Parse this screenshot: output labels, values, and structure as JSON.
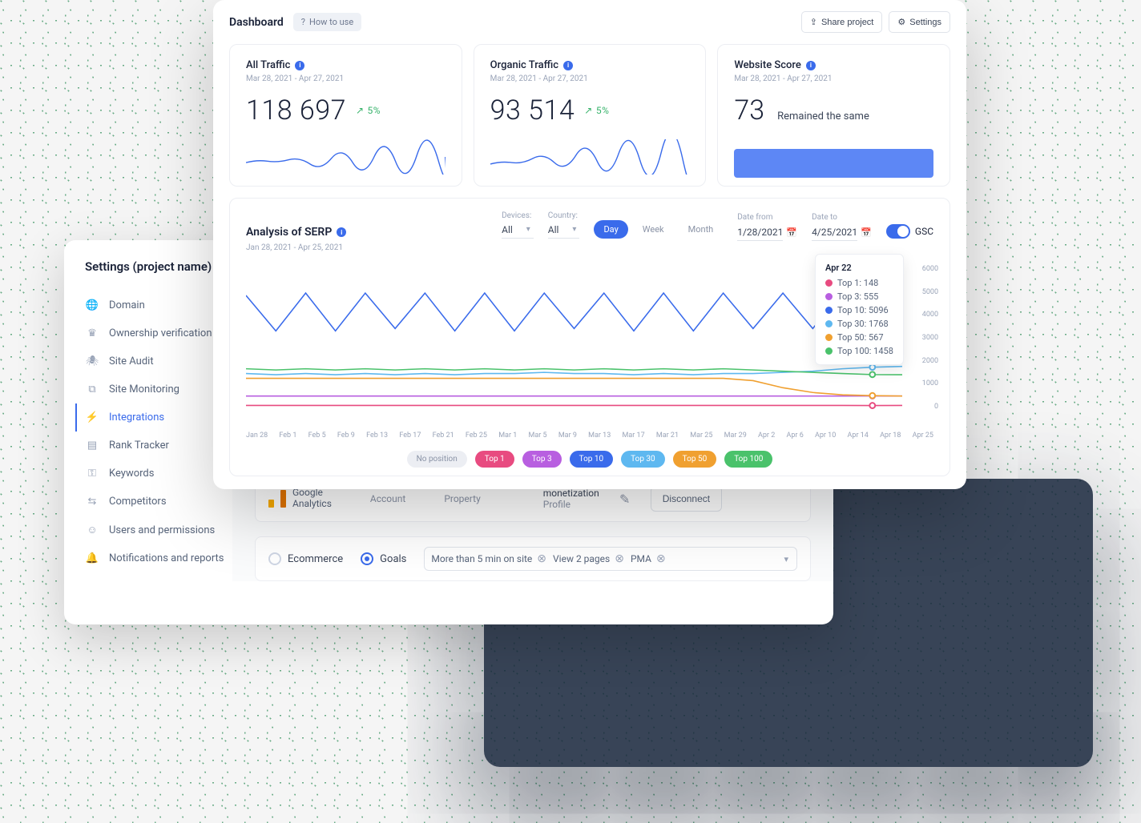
{
  "dashboard": {
    "title": "Dashboard",
    "howto": "How to use",
    "share": "Share project",
    "settings": "Settings"
  },
  "cards": {
    "traffic_all": {
      "title": "All Traffic",
      "date": "Mar 28, 2021 - Apr 27, 2021",
      "value": "118 697",
      "trend": "5%"
    },
    "traffic_org": {
      "title": "Organic Traffic",
      "date": "Mar 28, 2021 - Apr 27, 2021",
      "value": "93 514",
      "trend": "5%"
    },
    "score": {
      "title": "Website Score",
      "date": "Mar 28, 2021 - Apr 27, 2021",
      "value": "73",
      "text": "Remained the same"
    }
  },
  "serp": {
    "title": "Analysis of SERP",
    "sub": "Jan 28, 2021 - Apr 25, 2021",
    "devices_label": "Devices:",
    "devices": "All",
    "country_label": "Country:",
    "country": "All",
    "period_day": "Day",
    "period_week": "Week",
    "period_month": "Month",
    "date_from_label": "Date from",
    "date_from": "1/28/2021",
    "date_to_label": "Date to",
    "date_to": "4/25/2021",
    "gsc": "GSC",
    "tooltip_date": "Apr 22",
    "tt": [
      "Top 1: 148",
      "Top 3: 555",
      "Top 10: 5096",
      "Top 30: 1768",
      "Top 50: 567",
      "Top 100: 1458"
    ],
    "legend_noposition": "No position",
    "legend_top1": "Top 1",
    "legend_top3": "Top 3",
    "legend_top10": "Top 10",
    "legend_top30": "Top 30",
    "legend_top50": "Top 50",
    "legend_top100": "Top 100",
    "xticks": [
      "Jan 28",
      "Feb 1",
      "Feb 5",
      "Feb 9",
      "Feb 13",
      "Feb 17",
      "Feb 21",
      "Feb 25",
      "Mar 1",
      "Mar 5",
      "Mar 9",
      "Mar 13",
      "Mar 17",
      "Mar 21",
      "Mar 25",
      "Mar 29",
      "Apr 2",
      "Apr 6",
      "Apr 10",
      "Apr 14",
      "Apr 18",
      "Apr 25"
    ],
    "yticks": [
      "6000",
      "5000",
      "4000",
      "3000",
      "2000",
      "1000",
      "0"
    ]
  },
  "colors": {
    "top1": "#e84b80",
    "top3": "#b85fe0",
    "top10": "#3a6beb",
    "top30": "#5eb8f0",
    "top50": "#f0a030",
    "top100": "#4ac26b"
  },
  "settings_panel": {
    "title": "Settings (project name)",
    "items": [
      "Domain",
      "Ownership verification",
      "Site Audit",
      "Site Monitoring",
      "Integrations",
      "Rank Tracker",
      "Keywords",
      "Competitors",
      "Users and permissions",
      "Notifications and reports"
    ],
    "ga_name1": "Google",
    "ga_name2": "Analytics",
    "account_label": "Account",
    "property_label": "Property",
    "profile_val": "monetization",
    "profile_label": "Profile",
    "disconnect": "Disconnect",
    "ecommerce": "Ecommerce",
    "goals": "Goals",
    "tags": [
      "More than 5 min on site",
      "View 2 pages",
      "PMA"
    ]
  },
  "chart_data": {
    "type": "line",
    "xlabel": "",
    "ylabel": "",
    "ylim": [
      0,
      6000
    ],
    "categories": [
      "Jan 28",
      "Feb 1",
      "Feb 5",
      "Feb 9",
      "Feb 13",
      "Feb 17",
      "Feb 21",
      "Feb 25",
      "Mar 1",
      "Mar 5",
      "Mar 9",
      "Mar 13",
      "Mar 17",
      "Mar 21",
      "Mar 25",
      "Mar 29",
      "Apr 2",
      "Apr 6",
      "Apr 10",
      "Apr 14",
      "Apr 18",
      "Apr 22",
      "Apr 25"
    ],
    "series": [
      {
        "name": "Top 1",
        "color": "#e84b80",
        "values": [
          150,
          150,
          150,
          150,
          150,
          150,
          150,
          150,
          150,
          150,
          150,
          150,
          150,
          150,
          150,
          150,
          150,
          150,
          150,
          150,
          150,
          148,
          150
        ]
      },
      {
        "name": "Top 3",
        "color": "#b85fe0",
        "values": [
          550,
          550,
          550,
          550,
          550,
          550,
          550,
          550,
          550,
          550,
          550,
          550,
          550,
          550,
          550,
          550,
          550,
          550,
          550,
          550,
          550,
          555,
          550
        ]
      },
      {
        "name": "Top 10",
        "color": "#3a6beb",
        "values": [
          4800,
          3300,
          4900,
          3300,
          4900,
          3400,
          4900,
          3300,
          4900,
          3300,
          4900,
          3400,
          4900,
          3300,
          4900,
          3300,
          4900,
          3400,
          4900,
          3400,
          5000,
          5096,
          3600
        ]
      },
      {
        "name": "Top 30",
        "color": "#5eb8f0",
        "values": [
          1500,
          1450,
          1500,
          1450,
          1500,
          1450,
          1500,
          1450,
          1500,
          1500,
          1550,
          1500,
          1500,
          1450,
          1500,
          1450,
          1500,
          1500,
          1550,
          1600,
          1700,
          1768,
          1800
        ]
      },
      {
        "name": "Top 50",
        "color": "#f0a030",
        "values": [
          1300,
          1300,
          1300,
          1300,
          1300,
          1300,
          1300,
          1300,
          1300,
          1300,
          1300,
          1300,
          1300,
          1300,
          1300,
          1300,
          1300,
          1200,
          900,
          700,
          600,
          567,
          550
        ]
      },
      {
        "name": "Top 100",
        "color": "#4ac26b",
        "values": [
          1700,
          1650,
          1700,
          1650,
          1700,
          1650,
          1700,
          1650,
          1700,
          1650,
          1700,
          1650,
          1700,
          1650,
          1700,
          1650,
          1700,
          1650,
          1600,
          1550,
          1500,
          1458,
          1450
        ]
      }
    ]
  }
}
